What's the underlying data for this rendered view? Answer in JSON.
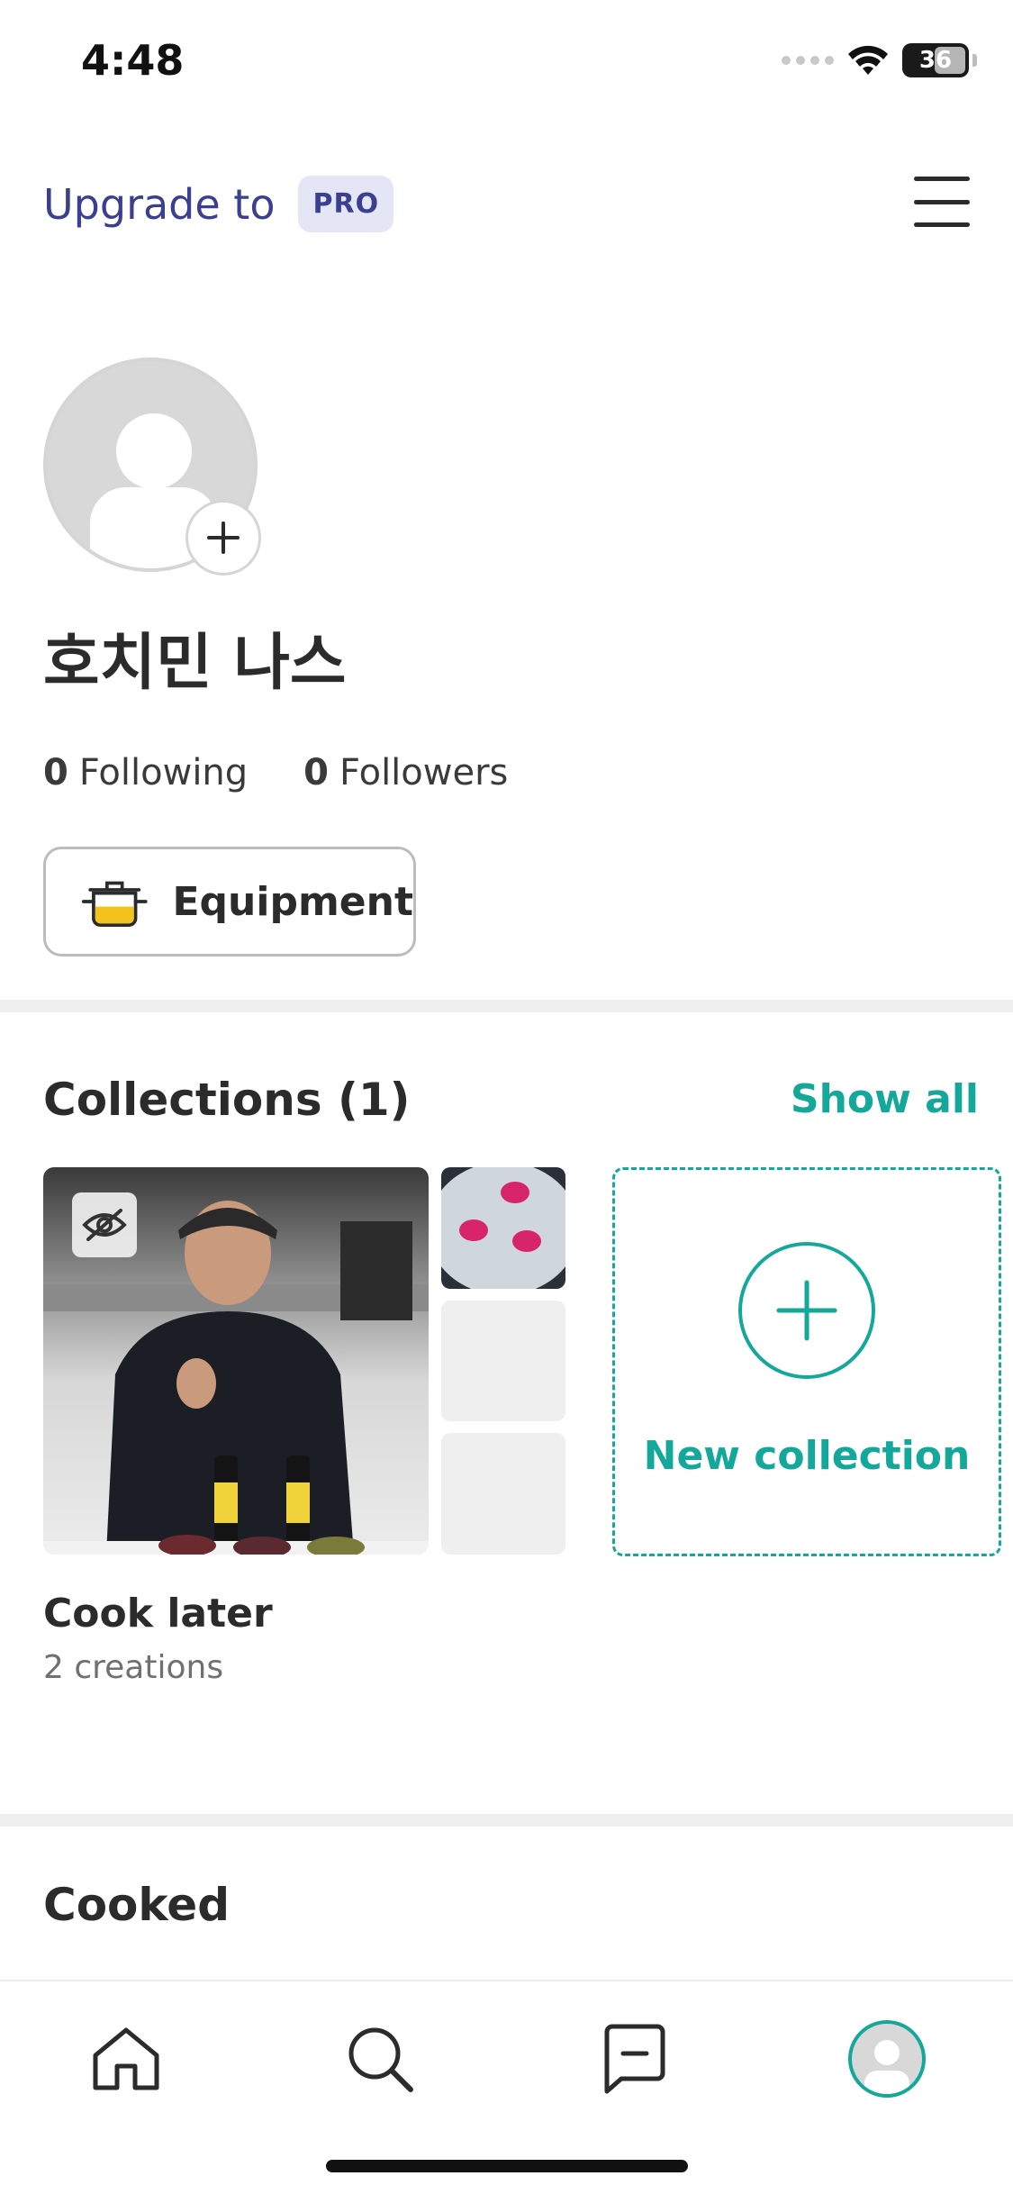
{
  "status_bar": {
    "time": "4:48",
    "battery": "36"
  },
  "header": {
    "upgrade_text": "Upgrade to",
    "pro_badge": "PRO"
  },
  "profile": {
    "name": "호치민 나스",
    "following_count": "0",
    "following_label": "Following",
    "followers_count": "0",
    "followers_label": "Followers",
    "equipment_label": "Equipment"
  },
  "collections": {
    "title": "Collections (1)",
    "show_all": "Show all",
    "items": [
      {
        "name": "Cook later",
        "count": "2 creations"
      }
    ],
    "new_collection_label": "New collection"
  },
  "cooked": {
    "title": "Cooked"
  },
  "tab_bar": {
    "tabs": [
      {
        "name": "home",
        "icon": "home-icon"
      },
      {
        "name": "search",
        "icon": "search-icon"
      },
      {
        "name": "messages",
        "icon": "message-icon"
      },
      {
        "name": "profile",
        "icon": "avatar-icon"
      }
    ]
  },
  "colors": {
    "accent": "#14a89a",
    "pro": "#3b3f8f",
    "text": "#2b2b2b"
  }
}
